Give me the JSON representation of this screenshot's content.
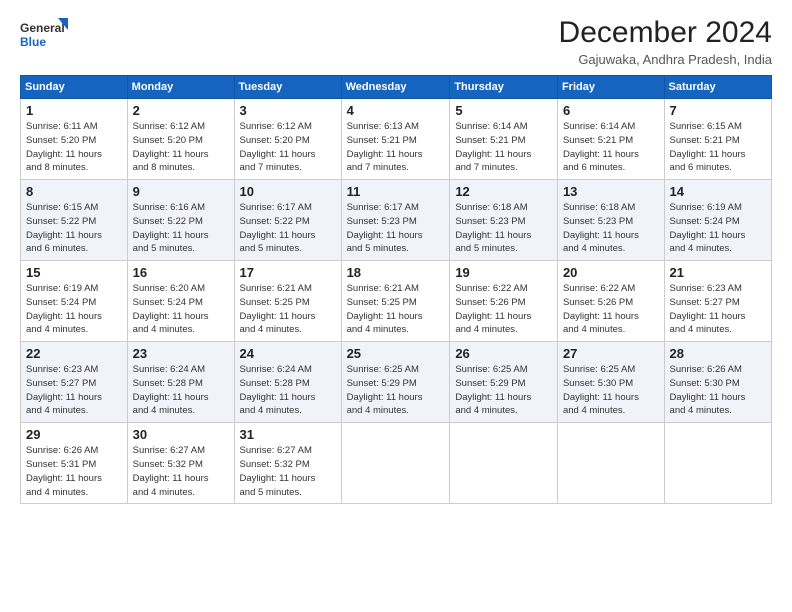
{
  "logo": {
    "line1": "General",
    "line2": "Blue"
  },
  "title": "December 2024",
  "subtitle": "Gajuwaka, Andhra Pradesh, India",
  "days_of_week": [
    "Sunday",
    "Monday",
    "Tuesday",
    "Wednesday",
    "Thursday",
    "Friday",
    "Saturday"
  ],
  "weeks": [
    [
      {
        "day": 1,
        "sunrise": "6:11 AM",
        "sunset": "5:20 PM",
        "daylight": "11 hours and 8 minutes."
      },
      {
        "day": 2,
        "sunrise": "6:12 AM",
        "sunset": "5:20 PM",
        "daylight": "11 hours and 8 minutes."
      },
      {
        "day": 3,
        "sunrise": "6:12 AM",
        "sunset": "5:20 PM",
        "daylight": "11 hours and 7 minutes."
      },
      {
        "day": 4,
        "sunrise": "6:13 AM",
        "sunset": "5:21 PM",
        "daylight": "11 hours and 7 minutes."
      },
      {
        "day": 5,
        "sunrise": "6:14 AM",
        "sunset": "5:21 PM",
        "daylight": "11 hours and 7 minutes."
      },
      {
        "day": 6,
        "sunrise": "6:14 AM",
        "sunset": "5:21 PM",
        "daylight": "11 hours and 6 minutes."
      },
      {
        "day": 7,
        "sunrise": "6:15 AM",
        "sunset": "5:21 PM",
        "daylight": "11 hours and 6 minutes."
      }
    ],
    [
      {
        "day": 8,
        "sunrise": "6:15 AM",
        "sunset": "5:22 PM",
        "daylight": "11 hours and 6 minutes."
      },
      {
        "day": 9,
        "sunrise": "6:16 AM",
        "sunset": "5:22 PM",
        "daylight": "11 hours and 5 minutes."
      },
      {
        "day": 10,
        "sunrise": "6:17 AM",
        "sunset": "5:22 PM",
        "daylight": "11 hours and 5 minutes."
      },
      {
        "day": 11,
        "sunrise": "6:17 AM",
        "sunset": "5:23 PM",
        "daylight": "11 hours and 5 minutes."
      },
      {
        "day": 12,
        "sunrise": "6:18 AM",
        "sunset": "5:23 PM",
        "daylight": "11 hours and 5 minutes."
      },
      {
        "day": 13,
        "sunrise": "6:18 AM",
        "sunset": "5:23 PM",
        "daylight": "11 hours and 4 minutes."
      },
      {
        "day": 14,
        "sunrise": "6:19 AM",
        "sunset": "5:24 PM",
        "daylight": "11 hours and 4 minutes."
      }
    ],
    [
      {
        "day": 15,
        "sunrise": "6:19 AM",
        "sunset": "5:24 PM",
        "daylight": "11 hours and 4 minutes."
      },
      {
        "day": 16,
        "sunrise": "6:20 AM",
        "sunset": "5:24 PM",
        "daylight": "11 hours and 4 minutes."
      },
      {
        "day": 17,
        "sunrise": "6:21 AM",
        "sunset": "5:25 PM",
        "daylight": "11 hours and 4 minutes."
      },
      {
        "day": 18,
        "sunrise": "6:21 AM",
        "sunset": "5:25 PM",
        "daylight": "11 hours and 4 minutes."
      },
      {
        "day": 19,
        "sunrise": "6:22 AM",
        "sunset": "5:26 PM",
        "daylight": "11 hours and 4 minutes."
      },
      {
        "day": 20,
        "sunrise": "6:22 AM",
        "sunset": "5:26 PM",
        "daylight": "11 hours and 4 minutes."
      },
      {
        "day": 21,
        "sunrise": "6:23 AM",
        "sunset": "5:27 PM",
        "daylight": "11 hours and 4 minutes."
      }
    ],
    [
      {
        "day": 22,
        "sunrise": "6:23 AM",
        "sunset": "5:27 PM",
        "daylight": "11 hours and 4 minutes."
      },
      {
        "day": 23,
        "sunrise": "6:24 AM",
        "sunset": "5:28 PM",
        "daylight": "11 hours and 4 minutes."
      },
      {
        "day": 24,
        "sunrise": "6:24 AM",
        "sunset": "5:28 PM",
        "daylight": "11 hours and 4 minutes."
      },
      {
        "day": 25,
        "sunrise": "6:25 AM",
        "sunset": "5:29 PM",
        "daylight": "11 hours and 4 minutes."
      },
      {
        "day": 26,
        "sunrise": "6:25 AM",
        "sunset": "5:29 PM",
        "daylight": "11 hours and 4 minutes."
      },
      {
        "day": 27,
        "sunrise": "6:25 AM",
        "sunset": "5:30 PM",
        "daylight": "11 hours and 4 minutes."
      },
      {
        "day": 28,
        "sunrise": "6:26 AM",
        "sunset": "5:30 PM",
        "daylight": "11 hours and 4 minutes."
      }
    ],
    [
      {
        "day": 29,
        "sunrise": "6:26 AM",
        "sunset": "5:31 PM",
        "daylight": "11 hours and 4 minutes."
      },
      {
        "day": 30,
        "sunrise": "6:27 AM",
        "sunset": "5:32 PM",
        "daylight": "11 hours and 4 minutes."
      },
      {
        "day": 31,
        "sunrise": "6:27 AM",
        "sunset": "5:32 PM",
        "daylight": "11 hours and 5 minutes."
      },
      null,
      null,
      null,
      null
    ]
  ]
}
